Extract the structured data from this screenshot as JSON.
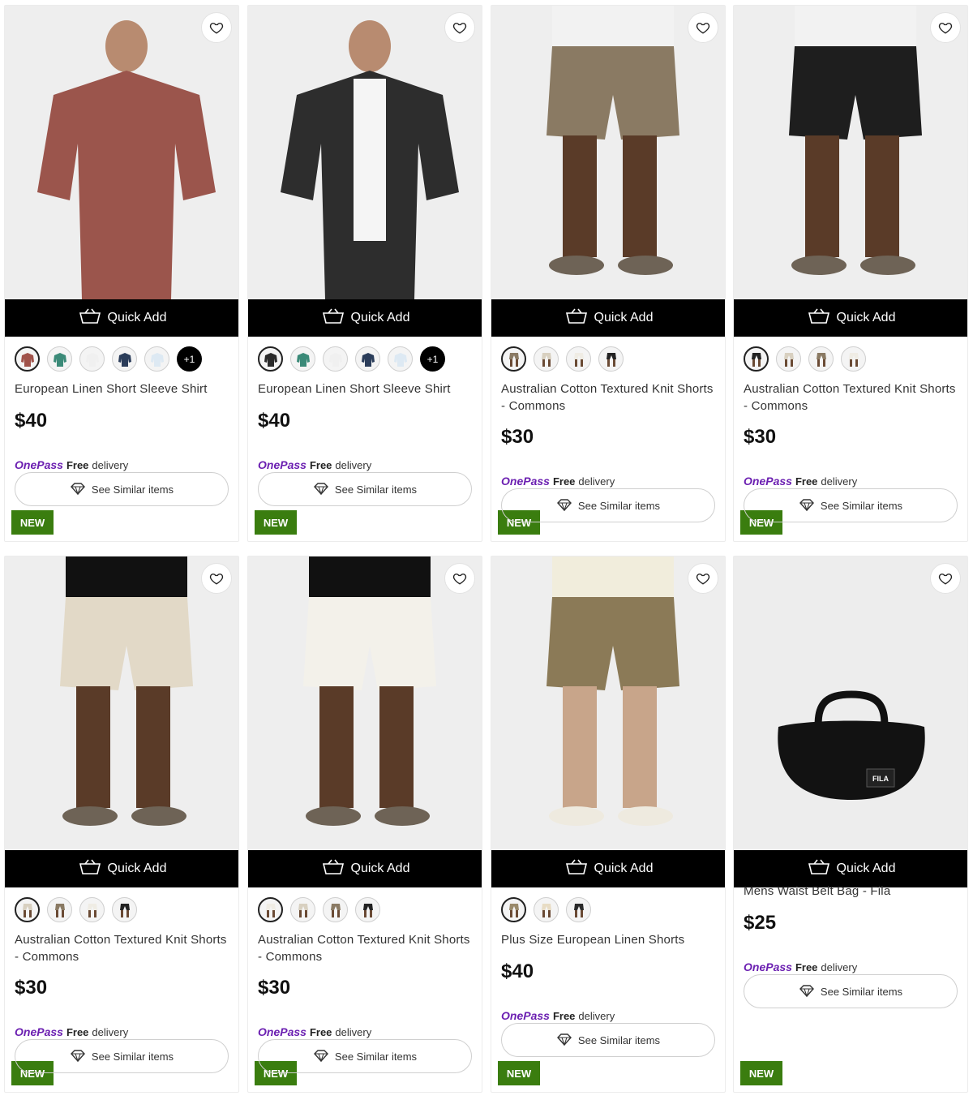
{
  "common": {
    "quick_add_label": "Quick Add",
    "new_badge": "NEW",
    "onepass_label": "OnePass",
    "free_label": "Free",
    "delivery_label": "delivery",
    "see_similar_label": "See Similar items"
  },
  "products": [
    {
      "name": "European Linen Short Sleeve Shirt",
      "price": "$40",
      "new": true,
      "more": "+1",
      "image": "shirt-model-red",
      "swatches": [
        "#a0524a",
        "#3b8a78",
        "#f0f0f0",
        "#2b3d5a",
        "#dde9f3"
      ]
    },
    {
      "name": "European Linen Short Sleeve Shirt",
      "price": "$40",
      "new": true,
      "more": "+1",
      "image": "shirt-model-black",
      "swatches": [
        "#2a2a2a",
        "#3b8a78",
        "#f0f0f0",
        "#2b3d5a",
        "#dde9f3"
      ]
    },
    {
      "name": "Australian Cotton Textured Knit Shorts - Commons",
      "price": "$30",
      "new": true,
      "image": "shorts-model-taupe",
      "swatches": [
        "#8a7a63",
        "#d8d0c0",
        "#efece4",
        "#222222"
      ]
    },
    {
      "name": "Australian Cotton Textured Knit Shorts - Commons",
      "price": "$30",
      "new": true,
      "image": "shorts-model-black",
      "swatches": [
        "#222222",
        "#d8d0c0",
        "#8a7a63",
        "#efece4"
      ]
    },
    {
      "name": "Australian Cotton Textured Knit Shorts - Commons",
      "price": "$30",
      "new": true,
      "image": "shorts-model-stone",
      "swatches": [
        "#d8d0c0",
        "#8a7a63",
        "#efece4",
        "#222222"
      ]
    },
    {
      "name": "Australian Cotton Textured Knit Shorts - Commons",
      "price": "$30",
      "new": true,
      "image": "shorts-model-white",
      "swatches": [
        "#efece4",
        "#d8d0c0",
        "#8a7a63",
        "#222222"
      ]
    },
    {
      "name": "Plus Size European Linen Shorts",
      "price": "$40",
      "new": true,
      "image": "shorts-model-khaki",
      "swatches": [
        "#9a8a6a",
        "#e8dcc4",
        "#2a2a2a"
      ]
    },
    {
      "name": "Mens Waist Belt Bag - Fila",
      "price": "$25",
      "new": true,
      "image": "waist-bag-black",
      "swatches": []
    }
  ],
  "colors": {
    "new_badge": "#3a7d0f",
    "onepass": "#6b1fb1",
    "quick_add_bg": "#000000"
  }
}
